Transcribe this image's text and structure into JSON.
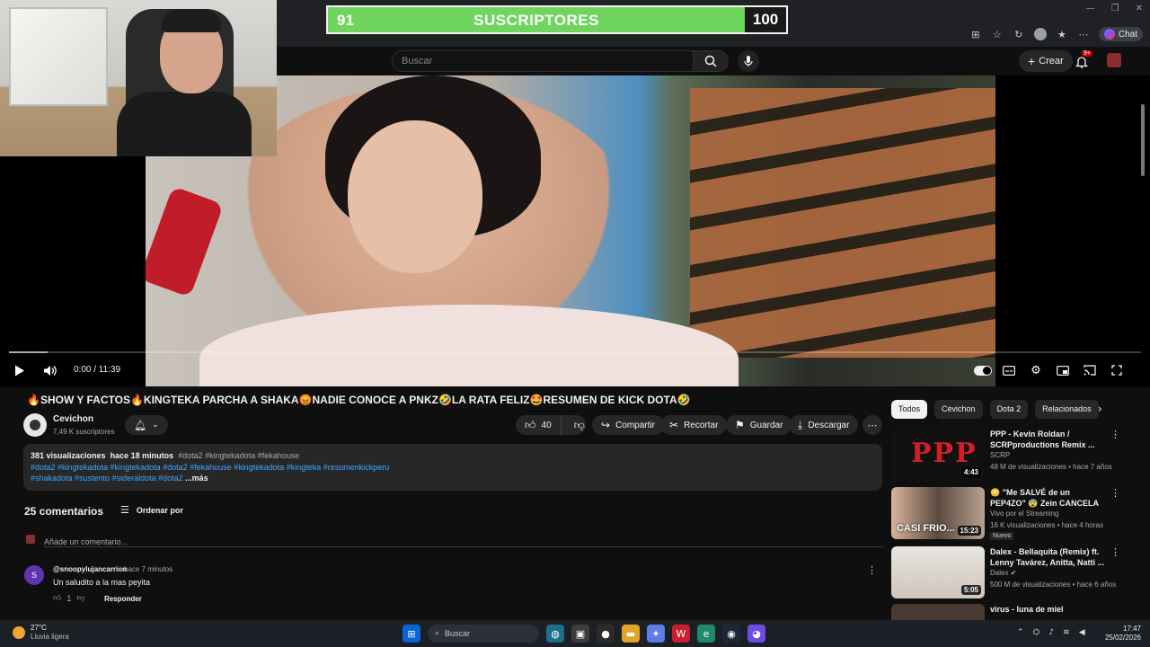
{
  "subscriber_goal": {
    "current": "91",
    "label": "SUSCRIPTORES",
    "goal": "100",
    "progress": 0.91,
    "fill_color": "#6fd55e"
  },
  "browser": {
    "chat_label": "Chat",
    "icons": [
      "extensions-icon",
      "bookmark-icon",
      "sync-icon",
      "profile-avatar",
      "favorites-icon",
      "menu-icon",
      "copilot-icon"
    ]
  },
  "header": {
    "search_placeholder": "Buscar",
    "create_label": "Crear",
    "notifications_badge": "9+"
  },
  "player": {
    "time": "0:00 / 11:39",
    "progress": 0,
    "buffered": 0.034
  },
  "video": {
    "title": "🔥SHOW Y FACTOS🔥KINGTEKA PARCHA A SHAKA😡NADIE CONOCE A PNKZ🤣LA RATA FELIZ🤩RESUMEN DE KICK DOTA🤣",
    "channel": "Cevichon",
    "subscribers": "7,49 K suscriptores",
    "likes": "40",
    "actions": {
      "share": "Compartir",
      "clip": "Recortar",
      "save": "Guardar",
      "download": "Descargar"
    }
  },
  "description": {
    "views": "381 visualizaciones",
    "age": "hace 18 minutos",
    "meta_tags": "#dota2 #kingtekadota #fekahouse",
    "tags_line1": "#dota2 #kingtekadota #kingtekadota #dota2 #fekahouse #kingtekadota #kingteka  #resumenkickperu",
    "tags_line2": "#shakadota #sustento #sideraldota #dota2 ",
    "more": "...más"
  },
  "comments": {
    "count": "25 comentarios",
    "sort_label": "Ordenar por",
    "add_placeholder": "Añade un comentario...",
    "items": [
      {
        "initial": "S",
        "author": "@snoopylujancarrion",
        "time": "hace 7 minutos",
        "text": "Un saludito a la mas peyita",
        "likes": "1",
        "reply": "Responder"
      }
    ]
  },
  "sidebar": {
    "chips": [
      "Todos",
      "Cevichon",
      "Dota 2",
      "Relacionados"
    ],
    "recommendations": [
      {
        "title": "PPP - Kevin Roldan / SCRPproductions Remix ...",
        "channel": "SCRP",
        "meta": "48 M de visualizaciones • hace 7 años",
        "duration": "4:43",
        "badge": ""
      },
      {
        "title": "😳 \"Me SALVÉ de un PEP4ZO\" 😨 Zein CANCELA ...",
        "channel": "Vivo por el Streaming",
        "meta": "16 K visualizaciones • hace 4 horas",
        "duration": "15:23",
        "badge": "Nuevo"
      },
      {
        "title": "Dalex - Bellaquita (Remix) ft. Lenny Tavárez, Anitta, Natti ...",
        "channel": "Dalex",
        "meta": "500 M de visualizaciones • hace 6 años",
        "duration": "5:05",
        "badge": ""
      },
      {
        "title": "virus - luna de miel",
        "channel": "",
        "meta": "",
        "duration": "",
        "badge": ""
      }
    ],
    "thumb_texts": [
      "PPP",
      "CASI FRIO..."
    ]
  },
  "taskbar": {
    "temperature": "27°C",
    "weather": "Lluvia ligera",
    "search_label": "Buscar",
    "time": "17:47",
    "date": "25/02/2026"
  }
}
